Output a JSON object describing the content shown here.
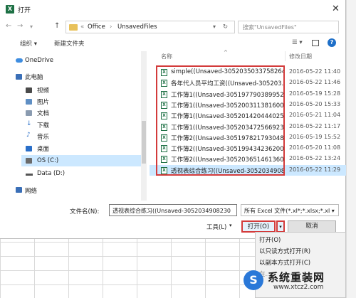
{
  "window": {
    "title": "打开",
    "app_icon": "excel-icon",
    "accent": "#1e7145"
  },
  "navigation": {
    "back": "←",
    "forward": "→",
    "up": "↑",
    "breadcrumb": [
      "«",
      "Office",
      "›",
      "UnsavedFiles"
    ],
    "search_placeholder": "搜索\"UnsavedFiles\""
  },
  "toolbar": {
    "organize": "组织 ▾",
    "new_folder": "新建文件夹"
  },
  "sidebar": {
    "items": [
      {
        "label": "OneDrive",
        "icon": "cloud-icon"
      },
      {
        "label": "此电脑",
        "icon": "computer-icon"
      },
      {
        "label": "视频",
        "icon": "video-icon"
      },
      {
        "label": "图片",
        "icon": "picture-icon"
      },
      {
        "label": "文档",
        "icon": "document-icon"
      },
      {
        "label": "下载",
        "icon": "download-icon"
      },
      {
        "label": "音乐",
        "icon": "music-icon"
      },
      {
        "label": "桌面",
        "icon": "desktop-icon"
      },
      {
        "label": "OS (C:)",
        "icon": "drive-icon"
      },
      {
        "label": "Data (D:)",
        "icon": "drive-icon"
      },
      {
        "label": "网络",
        "icon": "network-icon"
      }
    ]
  },
  "file_list": {
    "columns": {
      "name": "名称",
      "modified": "修改日期"
    },
    "files": [
      {
        "name": "simple((Unsaved-3052035033758264",
        "date": "2016-05-22 11:40"
      },
      {
        "name": "各年代人员平均工资((Unsaved-305203...",
        "date": "2016-05-22 11:46"
      },
      {
        "name": "工作簿1((Unsaved-3051977903899521...",
        "date": "2016-05-19 15:28"
      },
      {
        "name": "工作簿1((Unsaved-3052003113816006...",
        "date": "2016-05-20 15:33"
      },
      {
        "name": "工作簿1((Unsaved-3052014204440252...",
        "date": "2016-05-21 11:04"
      },
      {
        "name": "工作簿1((Unsaved-3052034725669230...",
        "date": "2016-05-22 11:17"
      },
      {
        "name": "工作簿2((Unsaved-3051978217930488...",
        "date": "2016-05-19 15:52"
      },
      {
        "name": "工作簿2((Unsaved-3051994342362000...",
        "date": "2016-05-20 11:08"
      },
      {
        "name": "工作簿2((Unsaved-3052036514613600...",
        "date": "2016-05-22 13:24"
      },
      {
        "name": "透视表综合练习((Unsaved-3052034908...",
        "date": "2016-05-22 11:29"
      }
    ],
    "selected_index": 9
  },
  "footer": {
    "filename_label": "文件名(N):",
    "filename_value": "透视表综合练习((Unsaved-3052034908230",
    "filetype": "所有 Excel 文件(*.xl*;*.xlsx;*.xl ▾",
    "tools": "工具(L)",
    "tools_arrow": "▾",
    "open": "打开(O)",
    "open_arrow": "▾",
    "cancel": "取消"
  },
  "open_menu": {
    "items": [
      "打开(O)",
      "以只读方式打开(R)",
      "以副本方式打开(C)",
      "在..."
    ]
  },
  "watermark": {
    "logo": "S",
    "title": "系统重装网",
    "url": "www.xtcz2.com"
  }
}
